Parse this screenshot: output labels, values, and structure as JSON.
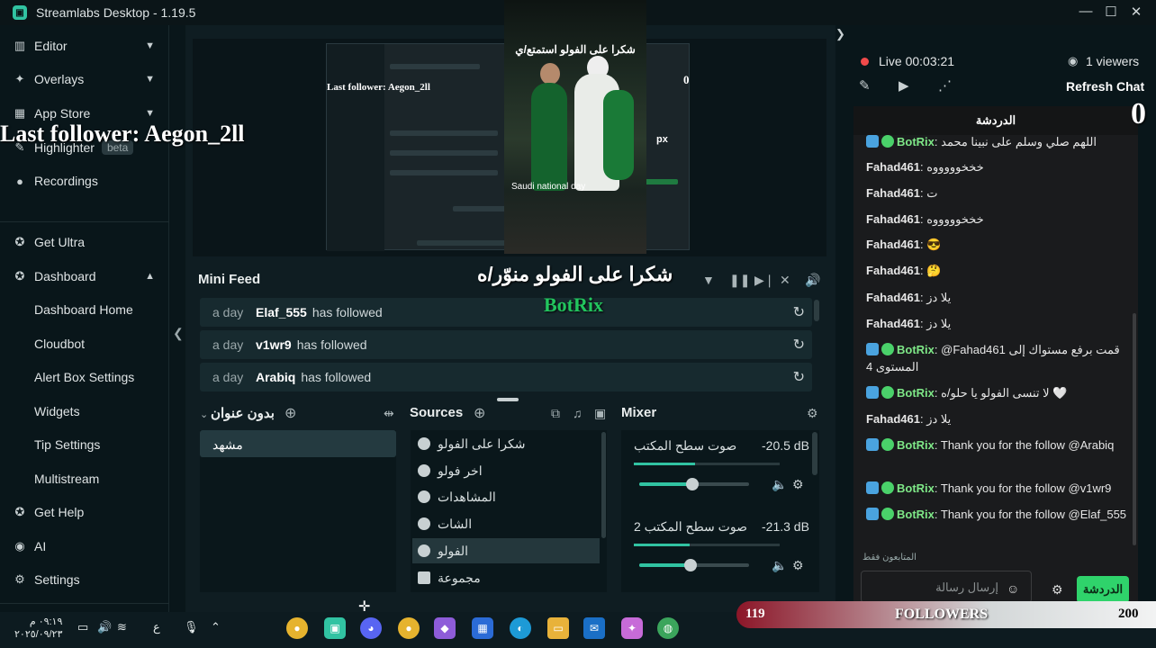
{
  "window": {
    "title": "Streamlabs Desktop - 1.19.5",
    "minimize": "—",
    "maximize": "☐",
    "close": "✕"
  },
  "sidebar": {
    "items": [
      {
        "label": "Editor",
        "icon": "editor-icon"
      },
      {
        "label": "Overlays",
        "icon": "overlays-icon"
      },
      {
        "label": "App Store",
        "icon": "app-store-icon"
      },
      {
        "label": "Highlighter",
        "badge": "beta",
        "icon": "highlighter-icon"
      },
      {
        "label": "Recordings",
        "icon": "recordings-icon"
      },
      {
        "label": "Get Ultra",
        "icon": "ultra-icon"
      },
      {
        "label": "Dashboard",
        "icon": "dashboard-icon"
      }
    ],
    "dashboard_sub": [
      "Dashboard Home",
      "Cloudbot",
      "Alert Box Settings",
      "Widgets",
      "Tip Settings",
      "Multistream"
    ],
    "bottom": [
      {
        "label": "Get Help",
        "icon": "help-icon"
      },
      {
        "label": "AI",
        "icon": "ai-icon"
      },
      {
        "label": "Settings",
        "icon": "settings-icon"
      }
    ]
  },
  "overlays": {
    "last_follower": "Last follower: Aegon_2ll",
    "thanks_arabic": "شكرا على الفولو منوّر/ه",
    "botrix": "BotRix",
    "zero": "0",
    "preview_last_follower": "Last follower: Aegon_2ll",
    "video_caption": "شكرا على الفولو استمتع/ي",
    "video_subcaption": "Saudi national day",
    "preview_zero": "0",
    "preview_px": "px"
  },
  "minifeed": {
    "title": "Mini Feed",
    "rows": [
      {
        "ago": "a day",
        "user": "Elaf_555",
        "action": "has followed"
      },
      {
        "ago": "a day",
        "user": "v1wr9",
        "action": "has followed"
      },
      {
        "ago": "a day",
        "user": "Arabiq",
        "action": "has followed"
      }
    ]
  },
  "scenes": {
    "title": "بدون عنوان",
    "items": [
      "مشهد"
    ]
  },
  "sources": {
    "title": "Sources",
    "items": [
      {
        "label": "شكرا على الفولو",
        "type": "browser"
      },
      {
        "label": "اخر فولو",
        "type": "browser"
      },
      {
        "label": "المشاهدات",
        "type": "browser"
      },
      {
        "label": "الشات",
        "type": "browser"
      },
      {
        "label": "الفولو",
        "type": "browser",
        "selected": true
      },
      {
        "label": "مجموعة",
        "type": "folder"
      }
    ]
  },
  "mixer": {
    "title": "Mixer",
    "channels": [
      {
        "name": "صوت سطح المكتب",
        "db": "-20.5 dB",
        "level": 0.42,
        "volume": 0.48
      },
      {
        "name": "صوت سطح المكتب 2",
        "db": "-21.3 dB",
        "level": 0.38,
        "volume": 0.47
      }
    ]
  },
  "live": {
    "status": "Live 00:03:21",
    "viewers": "1 viewers",
    "refresh_chat": "Refresh Chat"
  },
  "chat": {
    "header": "الدردشة",
    "messages": [
      {
        "user": "BotRix",
        "bot": true,
        "text": "اللهم صلي وسلم على نبينا محمد"
      },
      {
        "user": "Fahad461",
        "text": "خخخوووووه"
      },
      {
        "user": "Fahad461",
        "text": "ت"
      },
      {
        "user": "Fahad461",
        "text": "خخخوووووه"
      },
      {
        "user": "Fahad461",
        "text": "😎"
      },
      {
        "user": "Fahad461",
        "text": "🤔"
      },
      {
        "user": "Fahad461",
        "text": "يلا دز"
      },
      {
        "user": "Fahad461",
        "text": "يلا دز"
      },
      {
        "user": "BotRix",
        "bot": true,
        "text": "@Fahad461 قمت برفع مستواك إلى المستوى 4"
      },
      {
        "user": "BotRix",
        "bot": true,
        "text": "لا تنسى الفولو يا حلو/ه 🤍"
      },
      {
        "user": "Fahad461",
        "text": "يلا دز"
      },
      {
        "user": "BotRix",
        "bot": true,
        "text": "Thank you for the follow @Arabiq"
      },
      {
        "user": "BotRix",
        "bot": true,
        "text": "Thank you for the follow @v1wr9"
      },
      {
        "user": "BotRix",
        "bot": true,
        "text": "Thank you for the follow @Elaf_555"
      }
    ],
    "followers_only": "المتابعون فقط",
    "input_placeholder": "إرسال رسالة",
    "send_label": "الدردشة"
  },
  "followers_bar": {
    "current": "119",
    "label": "FOLLOWERS",
    "goal": "200"
  },
  "taskbar": {
    "time": "٠٩:١٩ م",
    "date": "٢٠٢٥/٠٩/٢٣",
    "lang": "ع"
  }
}
